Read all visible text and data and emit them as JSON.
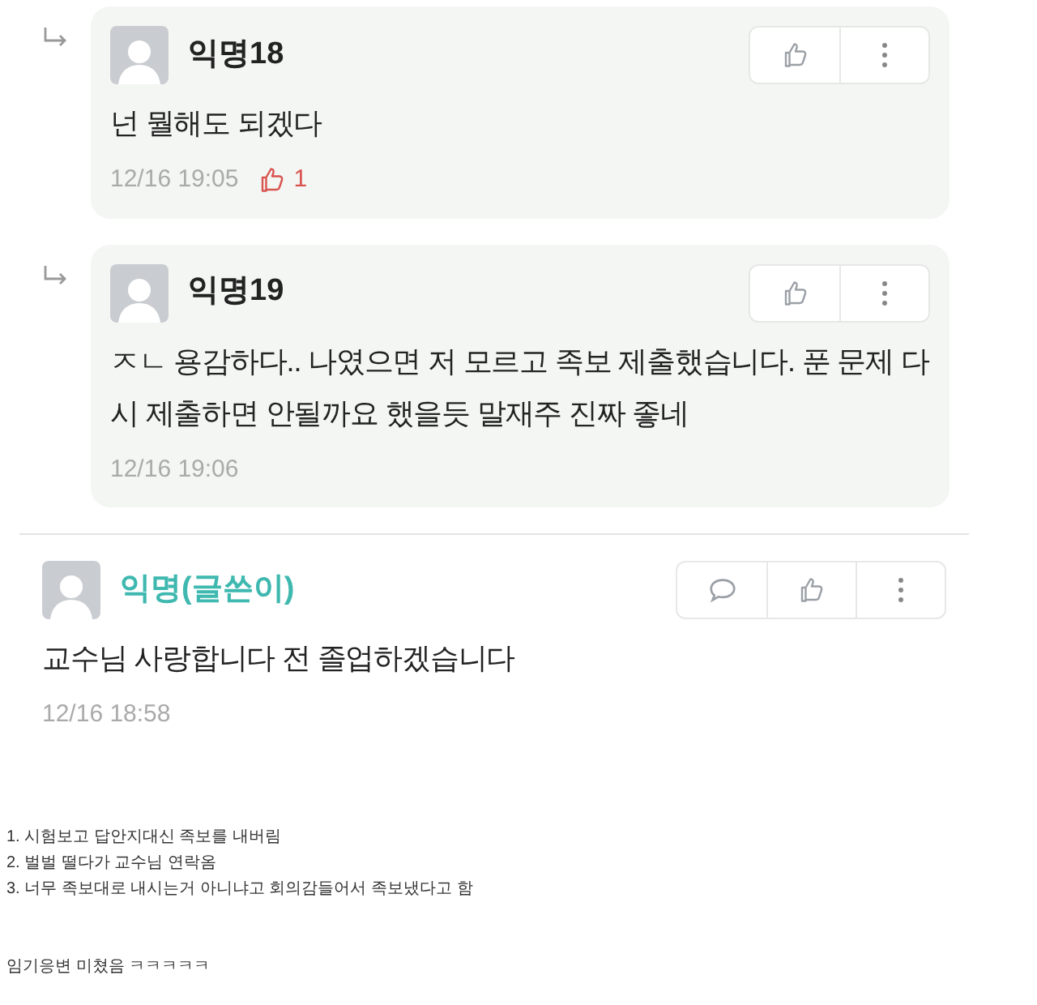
{
  "comments": [
    {
      "reply": true,
      "author": "익명18",
      "is_author": false,
      "body": "넌 뭘해도 되겠다",
      "time": "12/16 19:05",
      "likes": "1",
      "actions": [
        {
          "kind": "like"
        },
        {
          "kind": "more"
        }
      ]
    },
    {
      "reply": true,
      "author": "익명19",
      "is_author": false,
      "body": "ㅈㄴ 용감하다.. 나였으면 저 모르고 족보 제출했습니다. 푼 문제 다시 제출하면 안될까요 했을듯 말재주 진짜 좋네",
      "time": "12/16 19:06",
      "actions": [
        {
          "kind": "like"
        },
        {
          "kind": "more"
        }
      ]
    },
    {
      "reply": false,
      "author": "익명(글쓴이)",
      "is_author": true,
      "body": "교수님 사랑합니다 전 졸업하겠습니다",
      "time": "12/16 18:58",
      "actions": [
        {
          "kind": "comment"
        },
        {
          "kind": "like"
        },
        {
          "kind": "more"
        }
      ]
    }
  ],
  "notes": [
    "1. 시험보고 답안지대신 족보를 내버림",
    "2. 벌벌 떨다가 교수님 연락옴",
    "3. 너무 족보대로 내시는거 아니냐고 회의감들어서 족보냈다고 함"
  ],
  "closing": "임기응변 미쳤음 ㅋㅋㅋㅋㅋ"
}
